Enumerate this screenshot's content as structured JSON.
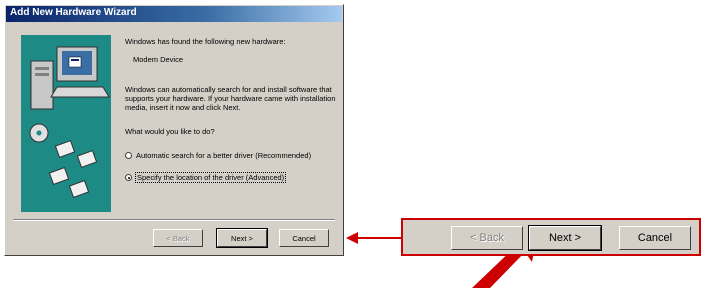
{
  "dialog": {
    "title": "Add New Hardware Wizard",
    "intro": "Windows has found the following new hardware:",
    "device": "Modem Device",
    "description": "Windows can automatically search for and install software that supports your hardware. If your hardware came with installation media, insert it now and click Next.",
    "question": "What would you like to do?",
    "options": [
      {
        "label": "Automatic search for a better driver (Recommended)",
        "selected": false
      },
      {
        "label": "Specify the location of the driver (Advanced)",
        "selected": true
      }
    ],
    "buttons": {
      "back": "< Back",
      "next": "Next >",
      "cancel": "Cancel"
    }
  },
  "zoom": {
    "back": "< Back",
    "next": "Next >",
    "cancel": "Cancel"
  },
  "colors": {
    "callout": "#cc0000",
    "art_bg": "#1d8a86",
    "face": "#d4d0c8"
  }
}
